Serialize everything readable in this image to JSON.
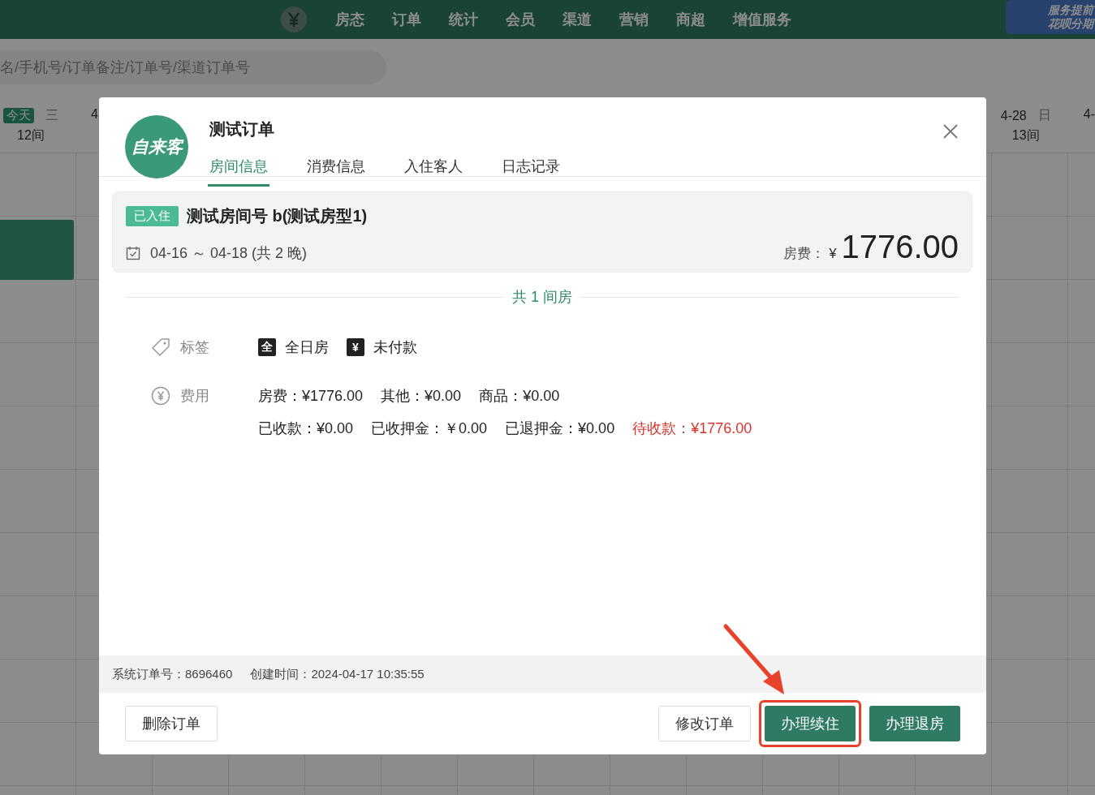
{
  "top_nav": {
    "items": [
      "房态",
      "订单",
      "统计",
      "会员",
      "渠道",
      "营销",
      "商超",
      "增值服务"
    ]
  },
  "promo_banner": [
    "服务提前",
    "花呗分期"
  ],
  "search": {
    "placeholder": "名/手机号/订单备注/订单号/渠道订单号"
  },
  "calendar": {
    "left": [
      {
        "badge": "今天",
        "weekday": "三",
        "count": "12间"
      },
      {
        "date": "4"
      }
    ],
    "right": [
      {
        "date": "4-28",
        "weekday": "日",
        "count": "13间"
      },
      {
        "date": "4-"
      }
    ]
  },
  "dialog": {
    "logo": "自来客",
    "title": "测试订单",
    "tabs": [
      {
        "label": "房间信息",
        "selected": true
      },
      {
        "label": "消费信息",
        "selected": false
      },
      {
        "label": "入住客人",
        "selected": false
      },
      {
        "label": "日志记录",
        "selected": false
      }
    ],
    "room": {
      "status": "已入住",
      "name": "测试房间号 b(测试房型1)",
      "dates": "04-16 ～ 04-18 (共 2 晚)",
      "fee_label": "房费：",
      "currency": "¥",
      "amount": "1776.00"
    },
    "room_count": "共 1 间房",
    "tags_label": "标签",
    "tags": [
      {
        "icon": "全",
        "label": "全日房"
      },
      {
        "icon": "¥",
        "label": "未付款"
      }
    ],
    "fees_label": "费用",
    "fees": [
      [
        {
          "text": "房费：¥1776.00",
          "kind": "normal"
        },
        {
          "text": "其他：¥0.00",
          "kind": "normal"
        },
        {
          "text": "商品：¥0.00",
          "kind": "normal"
        }
      ],
      [
        {
          "text": "已收款：¥0.00",
          "kind": "normal"
        },
        {
          "text": "已收押金：￥0.00",
          "kind": "normal"
        },
        {
          "text": "已退押金：¥0.00",
          "kind": "normal"
        },
        {
          "text": "待收款：¥1776.00",
          "kind": "due"
        }
      ]
    ],
    "footer_info": [
      "系统订单号：8696460",
      "创建时间：2024-04-17 10:35:55"
    ],
    "buttons": [
      {
        "label": "删除订单",
        "kind": "outline",
        "highlighted": false
      },
      {
        "label": "修改订单",
        "kind": "outline",
        "highlighted": false
      },
      {
        "label": "办理续住",
        "kind": "primary",
        "highlighted": true
      },
      {
        "label": "办理退房",
        "kind": "primary",
        "highlighted": false
      }
    ]
  }
}
